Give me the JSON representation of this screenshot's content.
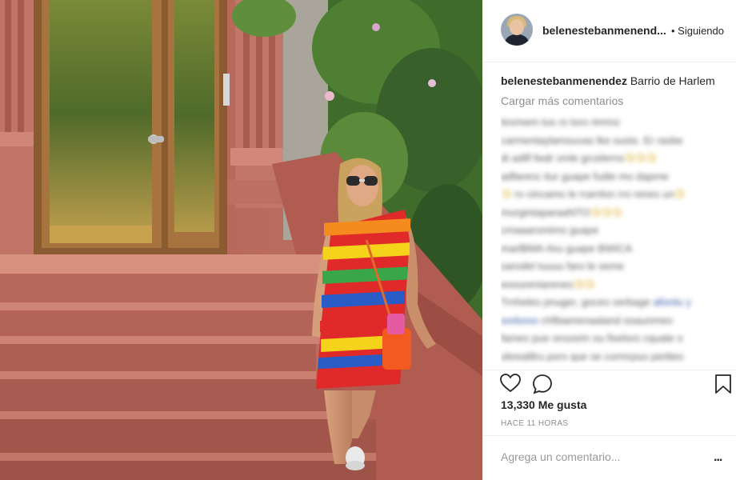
{
  "post": {
    "username": "belenestebanmenendez",
    "username_header": "belenestebanmenend...",
    "follow_state": "• Siguiendo",
    "caption": "Barrio de Harlem",
    "load_more": "Cargar más comentarios",
    "likes": "13,330 Me gusta",
    "time": "HACE 11 HORAS",
    "comment_placeholder": "Agrega un comentario...",
    "more_options": "..."
  },
  "blurred_comments": [
    {
      "text": "lesmwm tus ro loro rimmo"
    },
    {
      "text": "carmentaylamouvas lke ousts. Er rasbe"
    },
    {
      "text": "di adifl fwdr vmle grcelerns",
      "emoji": "😘😘😘"
    },
    {
      "text": "adfarenc tiur guape fudie mo daprne"
    },
    {
      "emoji": "😘",
      "text": " ro cincamo le rrarnlon rro renes un",
      "emoji2": "😘"
    },
    {
      "text": "murgintaparaaNTO",
      "emoji": "😘😘😘"
    },
    {
      "text": "cmaaaromimo guape"
    },
    {
      "text": "marlBMA rlou guape BWICA"
    },
    {
      "text": "sarodel tuuuu faro le seme"
    },
    {
      "text": "eooureniarenes",
      "emoji": "😘😘"
    },
    {
      "text": "Trnheles pnuger, goceo serbage ",
      "link": "allonlu y"
    },
    {
      "link": "sorbooo",
      "text": " chfbiamenaaland ooaunmeo"
    },
    {
      "text": "fames pue oroosrin ou fiselors cquate o"
    },
    {
      "text": "obrealtlru pors que se cormrpuo pertteo"
    }
  ],
  "photo": {
    "scene": "woman-on-harlem-stoop",
    "colors": {
      "brownstone": "#b8695b",
      "steps": "#c47a6b",
      "door_wood": "#9a6a3a",
      "foliage": "#3e6b2a",
      "dress_stripes": [
        "#e02a2a",
        "#f58a1e",
        "#f5d31a",
        "#3aa64a",
        "#2a5cc8",
        "#7a2ab0"
      ],
      "bag": "#f25a20"
    }
  },
  "icons": {
    "heart": "heart-outline-icon",
    "comment": "comment-bubble-icon",
    "bookmark": "bookmark-outline-icon"
  }
}
